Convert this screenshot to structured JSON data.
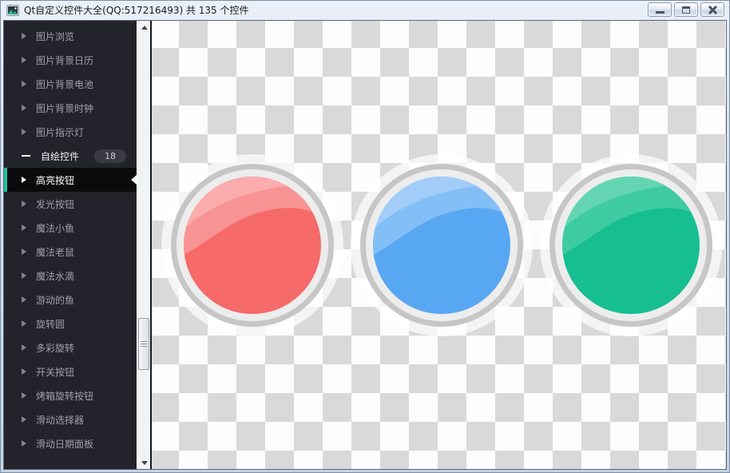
{
  "theme": {
    "accent": "#1EC2A0",
    "sidebar_bg": "#23242B",
    "sidebar_selected_bg": "#0B0B0E",
    "checker_light": "#FDFDFD",
    "checker_dark": "#D9D9D9"
  },
  "window": {
    "title": "Qt自定义控件大全(QQ:517216493) 共 135 个控件",
    "icon": "picture-icon",
    "controls": [
      "minimize-icon",
      "maximize-icon",
      "close-icon"
    ]
  },
  "sidebar": {
    "items": [
      {
        "label": "图片浏览"
      },
      {
        "label": "图片背景日历"
      },
      {
        "label": "图片背景电池"
      },
      {
        "label": "图片背景时钟"
      },
      {
        "label": "图片指示灯"
      },
      {
        "label": "自绘控件",
        "badge": "18",
        "state": "expanded"
      },
      {
        "label": "高亮按钮",
        "selected": true
      },
      {
        "label": "发光按钮"
      },
      {
        "label": "魔法小鱼"
      },
      {
        "label": "魔法老鼠"
      },
      {
        "label": "魔法水滴"
      },
      {
        "label": "游动的鱼"
      },
      {
        "label": "旋转圆"
      },
      {
        "label": "多彩旋转"
      },
      {
        "label": "开关按钮"
      },
      {
        "label": "烤箱旋转按钮"
      },
      {
        "label": "滑动选择器"
      },
      {
        "label": "滑动日期面板"
      }
    ]
  },
  "main": {
    "ring": {
      "glow": "#FFFFFF",
      "outer": "#C6C6C6",
      "inner": "#EDEDED"
    },
    "buttons": [
      {
        "name": "red-highlight-button",
        "base": "#F66A6A",
        "gloss": "#F89393",
        "streak": "#FBACAC"
      },
      {
        "name": "blue-highlight-button",
        "base": "#58A7F3",
        "gloss": "#83BFF7",
        "streak": "#A2CDF9"
      },
      {
        "name": "green-highlight-button",
        "base": "#16BE90",
        "gloss": "#3ECBA2",
        "streak": "#63D5B2"
      }
    ]
  }
}
